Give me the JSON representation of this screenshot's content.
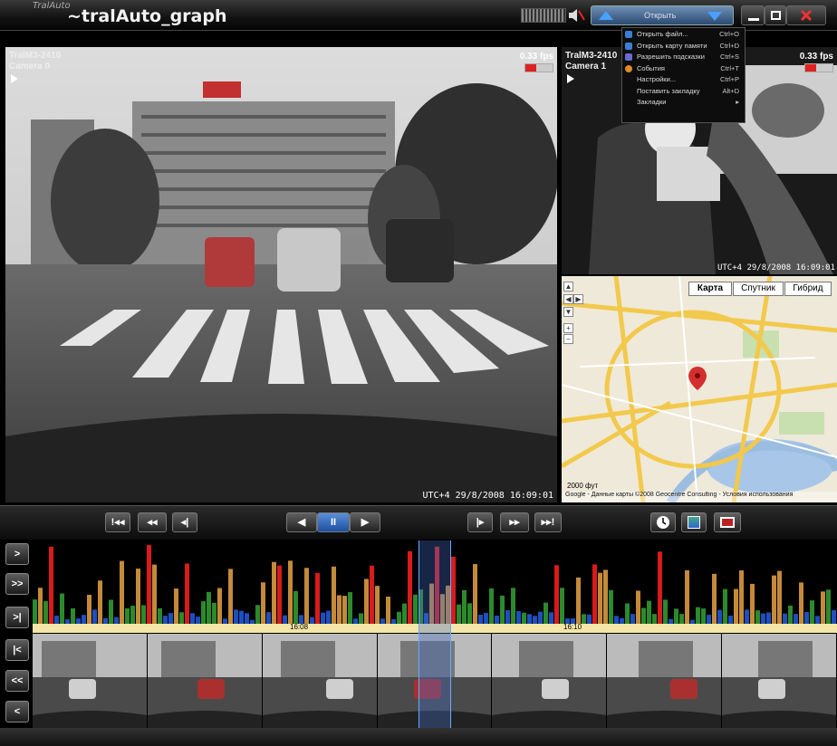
{
  "app": {
    "logo": "TralAuto",
    "title": "~tralAuto_graph"
  },
  "menu": {
    "button_label": "Открыть",
    "items": [
      {
        "label": "Открыть файл...",
        "shortcut": "Ctrl+O",
        "icon": "folder-icon",
        "color": "#3a7fd5"
      },
      {
        "label": "Открыть карту памяти",
        "shortcut": "Ctrl+D",
        "icon": "card-icon",
        "color": "#3a7fd5"
      },
      {
        "label": "Разрешить подсказки",
        "shortcut": "Ctrl+S",
        "icon": "hint-icon",
        "color": "#6a6ad5"
      },
      {
        "label": "События",
        "shortcut": "Ctrl+T",
        "icon": "events-icon",
        "color": "#e08a2a"
      },
      {
        "label": "Настройки...",
        "shortcut": "Ctrl+P",
        "icon": "",
        "color": ""
      },
      {
        "label": "Поставить закладку",
        "shortcut": "Alt+D",
        "icon": "",
        "color": ""
      },
      {
        "label": "Закладки",
        "shortcut": "▸",
        "icon": "",
        "color": ""
      }
    ]
  },
  "cameras": [
    {
      "model": "TralM3-2410",
      "name": "Camera 0",
      "fps": "0.33 fps",
      "timestamp": "UTC+4 29/8/2008 16:09:01"
    },
    {
      "model": "TralM3-2410",
      "name": "Camera 1",
      "fps": "0.33 fps",
      "timestamp": "UTC+4 29/8/2008 16:09:01"
    }
  ],
  "map": {
    "tabs": [
      "Карта",
      "Спутник",
      "Гибрид"
    ],
    "scale": "2000 фут",
    "footer": "Google - Данные карты ©2008 Geocentre Consulting - Условия использования"
  },
  "transport": {
    "buttons": [
      "!◂◂",
      "◂◂",
      "◂|",
      "◀",
      "II",
      "▶",
      "|▸",
      "▸▸",
      "▸▸!"
    ]
  },
  "sidenav": [
    ">",
    ">>",
    ">|",
    "|<",
    "<<",
    "<"
  ],
  "timeline": {
    "labels": [
      "16:08",
      "16:10"
    ]
  },
  "colors": {
    "accent": "#3a7fd5",
    "hist_red": "#d81b1b",
    "hist_green": "#2c8a2c",
    "hist_blue": "#1d4fc0",
    "hist_orange": "#c48a3a",
    "timeline": "#f3e6a6"
  }
}
